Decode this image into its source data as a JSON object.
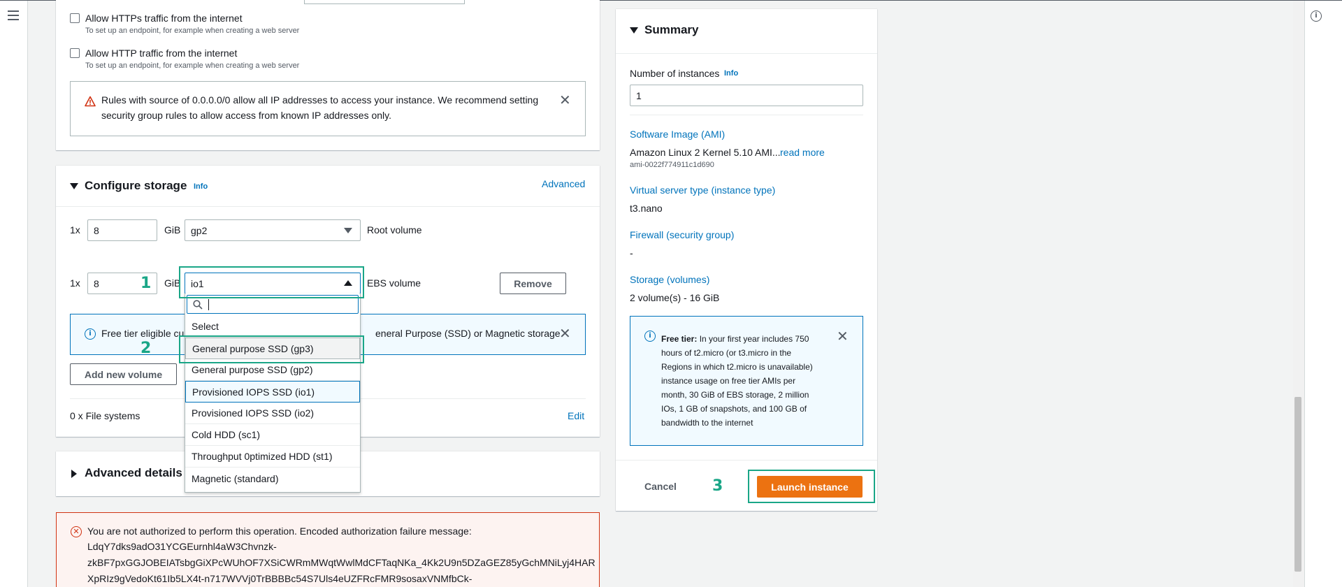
{
  "security": {
    "https_label": "Allow HTTPs traffic from the internet",
    "https_hint": "To set up an endpoint, for example when creating a web server",
    "http_label": "Allow HTTP traffic from the internet",
    "http_hint": "To set up an endpoint, for example when creating a web server",
    "warning_line1": "Rules with source of 0.0.0.0/0 allow all IP addresses to access your instance. We recommend setting",
    "warning_line2": "security group rules to allow access from known IP addresses only."
  },
  "storage": {
    "title": "Configure storage",
    "info": "Info",
    "advanced": "Advanced",
    "row1": {
      "count": "1x",
      "size": "8",
      "unit": "GiB",
      "type": "gp2",
      "desc": "Root volume"
    },
    "row2": {
      "count": "1x",
      "size": "8",
      "unit": "GiB",
      "type": "io1",
      "desc": "EBS volume",
      "remove": "Remove"
    },
    "free_tier_prefix": "Free tier eligible cu",
    "free_tier_suffix": "eneral Purpose (SSD) or Magnetic storage",
    "add_volume": "Add new volume",
    "file_systems": "0 x File systems",
    "edit": "Edit"
  },
  "dropdown": {
    "search_placeholder": "",
    "options": [
      "Select",
      "General purpose SSD (gp3)",
      "General purpose SSD (gp2)",
      "Provisioned IOPS SSD (io1)",
      "Provisioned IOPS SSD (io2)",
      "Cold HDD (sc1)",
      "Throughput 0ptimized HDD (st1)",
      "Magnetic (standard)"
    ]
  },
  "advanced_details": {
    "title": "Advanced details"
  },
  "error": {
    "line1": "You are not authorized to perform this operation. Encoded authorization failure message:",
    "line2": "LdqY7dks9adO31YCGEurnhl4aW3Chvnzk-",
    "line3": "zkBF7pxGGJOBEIATsbgGiXPcWUhOF7XSiCWRmMWqtWwlMdCFTaqNKa_4Kk2U9n5DZaGEZ85yGchMNiLyj4HAR",
    "line4": "XpRIz9gVedoKt61Ib5LX4t-n717WVVj0TrBBBBc54S7Uls4eUZFRcFMR9sosaxVNMfbCk-"
  },
  "summary": {
    "title": "Summary",
    "instances_label": "Number of instances",
    "instances_info": "Info",
    "instances_value": "1",
    "ami_label": "Software Image (AMI)",
    "ami_value": "Amazon Linux 2 Kernel 5.10 AMI...",
    "ami_read_more": "read more",
    "ami_id": "ami-0022f774911c1d690",
    "type_label": "Virtual server type (instance type)",
    "type_value": "t3.nano",
    "firewall_label": "Firewall (security group)",
    "firewall_value": "-",
    "storage_label": "Storage (volumes)",
    "storage_value": "2 volume(s) - 16 GiB",
    "free_tier_title": "Free tier:",
    "free_tier_lines": [
      " In your first year includes 750",
      "hours of t2.micro (or t3.micro in the",
      "Regions in which t2.micro is unavailable)",
      "instance usage on free tier AMIs per",
      "month, 30 GiB of EBS storage, 2 million",
      "IOs, 1 GB of snapshots, and 100 GB of",
      "bandwidth to the internet"
    ],
    "cancel": "Cancel",
    "launch": "Launch instance"
  },
  "annotations": {
    "step1": "1",
    "step2": "2",
    "step3": "3"
  },
  "colors": {
    "accent_teal": "#1aa687",
    "launch_orange": "#ec7211",
    "link_blue": "#0073bb",
    "error_red": "#d13212"
  },
  "icons": [
    "hamburger-icon",
    "info-circle-icon",
    "warning-triangle-icon",
    "close-icon",
    "search-icon",
    "chevron-down-icon",
    "chevron-up-icon",
    "info-icon",
    "error-icon"
  ]
}
